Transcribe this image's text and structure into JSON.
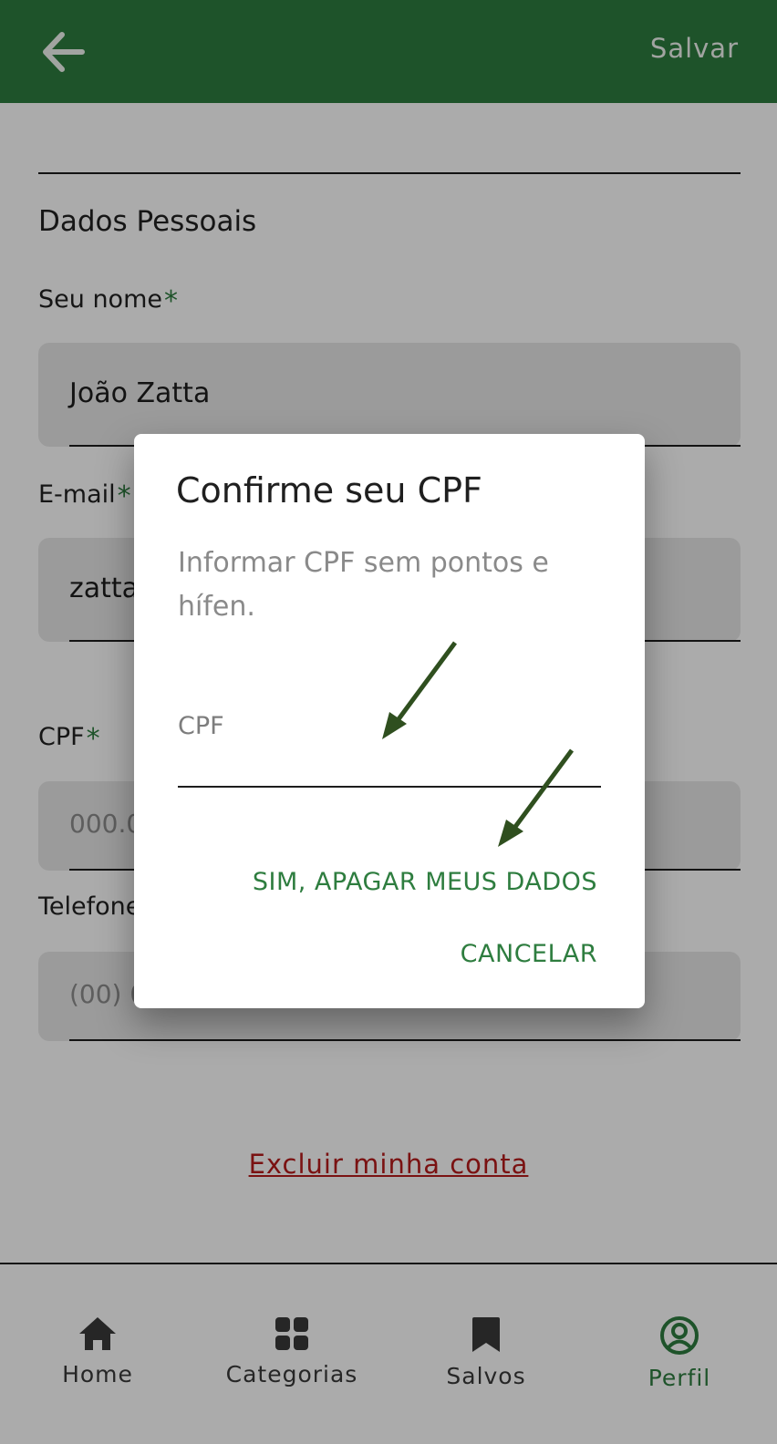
{
  "appbar": {
    "save_label": "Salvar",
    "back_icon": "arrow-left-icon",
    "background": "#2e7d3f"
  },
  "form": {
    "section_title": "Dados Pessoais",
    "name": {
      "label": "Seu nome",
      "required_mark": "*",
      "value": "João Zatta"
    },
    "email": {
      "label": "E-mail",
      "required_mark": "*",
      "value": "zatta"
    },
    "cpf": {
      "label": "CPF",
      "required_mark": "*",
      "placeholder": "000.0"
    },
    "phone": {
      "label": "Telefone",
      "placeholder": "(00) 0"
    },
    "delete_account_label": "Excluir minha conta"
  },
  "dialog": {
    "title": "Confirme seu CPF",
    "message": "Informar CPF sem pontos e hífen.",
    "cpf_placeholder": "CPF",
    "confirm_label": "SIM, APAGAR MEUS DADOS",
    "cancel_label": "CANCELAR"
  },
  "bottom_nav": {
    "items": [
      {
        "label": "Home",
        "icon": "home-icon",
        "active": false
      },
      {
        "label": "Categorias",
        "icon": "grid-icon",
        "active": false
      },
      {
        "label": "Salvos",
        "icon": "bookmark-icon",
        "active": false
      },
      {
        "label": "Perfil",
        "icon": "account-circle-icon",
        "active": true
      }
    ]
  },
  "colors": {
    "accent": "#2e7d3f",
    "danger": "#b71c1c",
    "annotation_arrow": "#2f4f1f"
  }
}
